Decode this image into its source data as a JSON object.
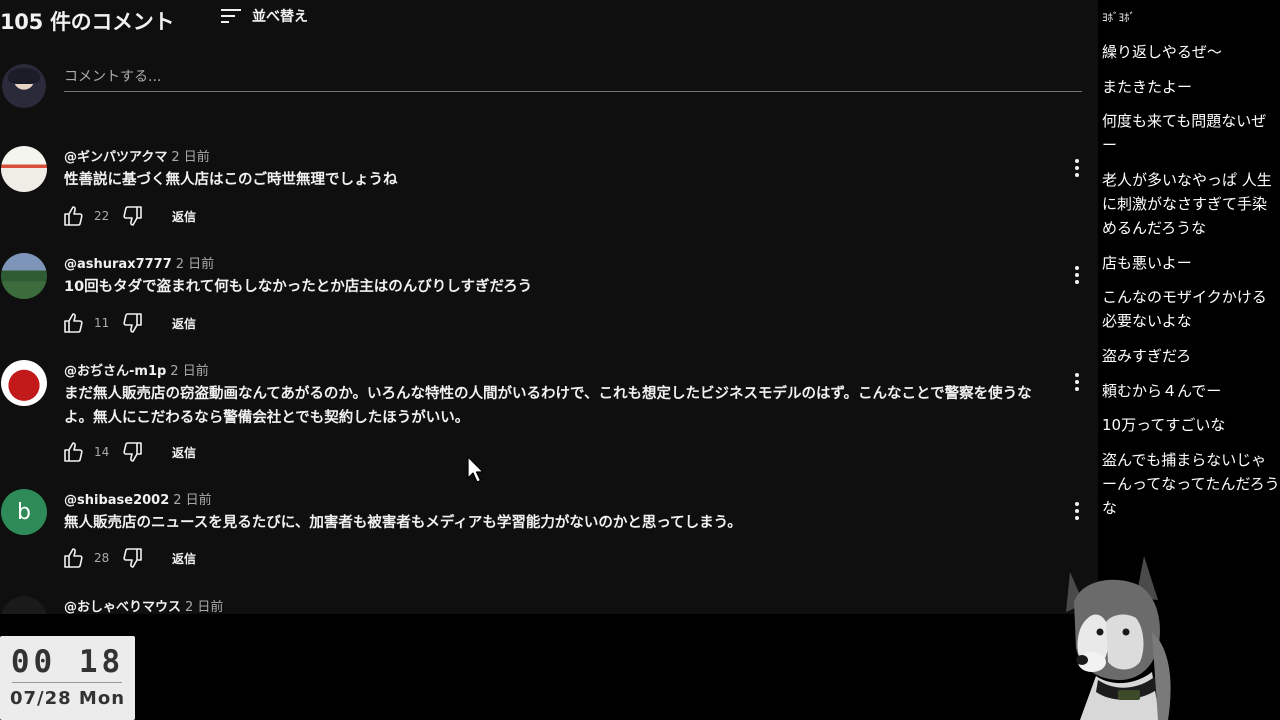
{
  "header": {
    "comment_count": "105 件のコメント",
    "sort_label": "並べ替え"
  },
  "add_comment": {
    "placeholder": "コメントする..."
  },
  "comments": [
    {
      "author": "@ギンパツアクマ",
      "time": "2 日前",
      "text": "性善説に基づく無人店はこのご時世無理でしょうね",
      "likes": "22",
      "reply_label": "返信"
    },
    {
      "author": "@ashurax7777",
      "time": "2 日前",
      "text": "10回もタダで盗まれて何もしなかったとか店主はのんびりしすぎだろう",
      "likes": "11",
      "reply_label": "返信"
    },
    {
      "author": "@おぢさん-m1p",
      "time": "2 日前",
      "text": "まだ無人販売店の窃盗動画なんてあがるのか。いろんな特性の人間がいるわけで、これも想定したビジネスモデルのはず。こんなことで警察を使うなよ。無人にこだわるなら警備会社とでも契約したほうがいい。",
      "likes": "14",
      "reply_label": "返信"
    },
    {
      "author": "@shibase2002",
      "time": "2 日前",
      "text": "無人販売店のニュースを見るたびに、加害者も被害者もメディアも学習能力がないのかと思ってしまう。",
      "likes": "28",
      "reply_label": "返信",
      "avatar_letter": "b"
    },
    {
      "author": "@おしゃべりマウス",
      "time": "2 日前"
    }
  ],
  "chat": [
    "ﾖﾎﾞﾖﾎﾞ",
    "繰り返しやるぜ～",
    "またきたよー",
    "何度も来ても問題ないぜー",
    "老人が多いなやっぱ 人生に刺激がなさすぎて手染めるんだろうな",
    "店も悪いよー",
    "こんなのモザイクかける必要ないよな",
    "盗みすぎだろ",
    "頼むから４んでー",
    "10万ってすごいな",
    "盗んでも捕まらないじゃーんってなってたんだろうな"
  ],
  "clock": {
    "time": "00 18",
    "date": "07/28 Mon"
  },
  "colors": {
    "background": "#0f0f0f",
    "text_primary": "#f1f1f1",
    "text_secondary": "#aaaaaa",
    "avatar_b": "#2e8b57",
    "clock_bg": "#ececec"
  },
  "icons": [
    "sort-icon",
    "like-icon",
    "dislike-icon",
    "more-icon",
    "cursor-icon",
    "husky-mascot"
  ]
}
